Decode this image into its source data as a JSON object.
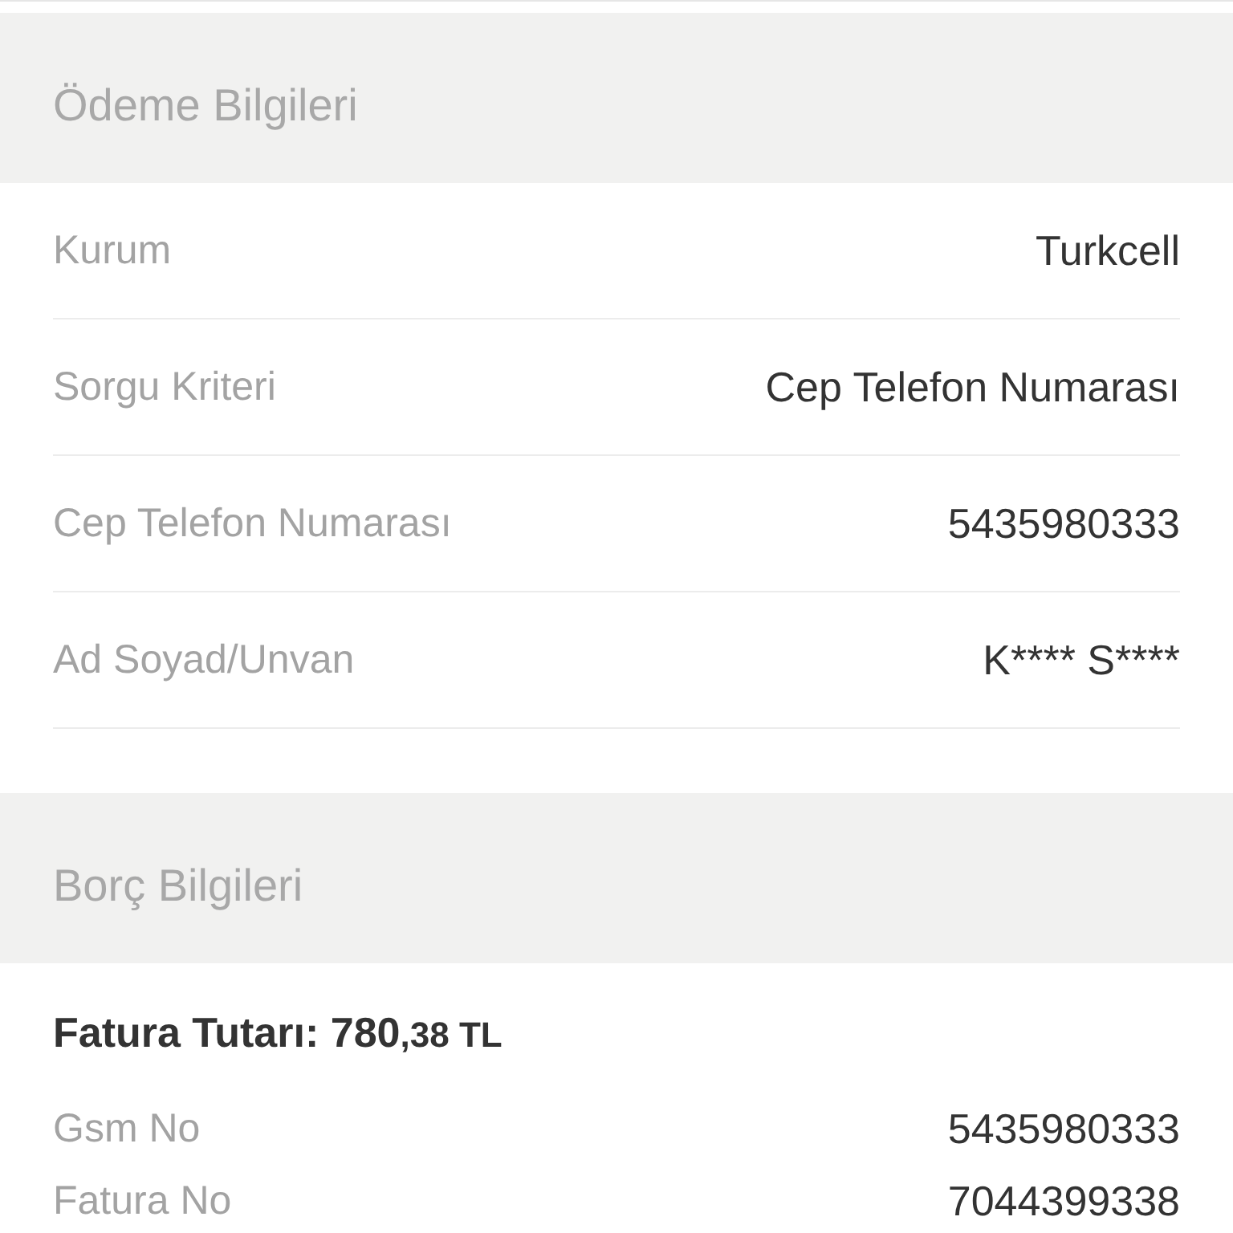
{
  "payment_section": {
    "title": "Ödeme Bilgileri",
    "rows": [
      {
        "label": "Kurum",
        "value": "Turkcell"
      },
      {
        "label": "Sorgu Kriteri",
        "value": "Cep Telefon Numarası"
      },
      {
        "label": "Cep Telefon Numarası",
        "value": "5435980333"
      },
      {
        "label": "Ad Soyad/Unvan",
        "value": "K**** S****"
      }
    ]
  },
  "debt_section": {
    "title": "Borç Bilgileri",
    "total": {
      "label": "Fatura Tutarı:",
      "amount": "780",
      "fraction": ",38",
      "currency": "TL"
    },
    "rows": [
      {
        "label": "Gsm No",
        "value": "5435980333"
      },
      {
        "label": "Fatura No",
        "value": "7044399338"
      }
    ]
  }
}
